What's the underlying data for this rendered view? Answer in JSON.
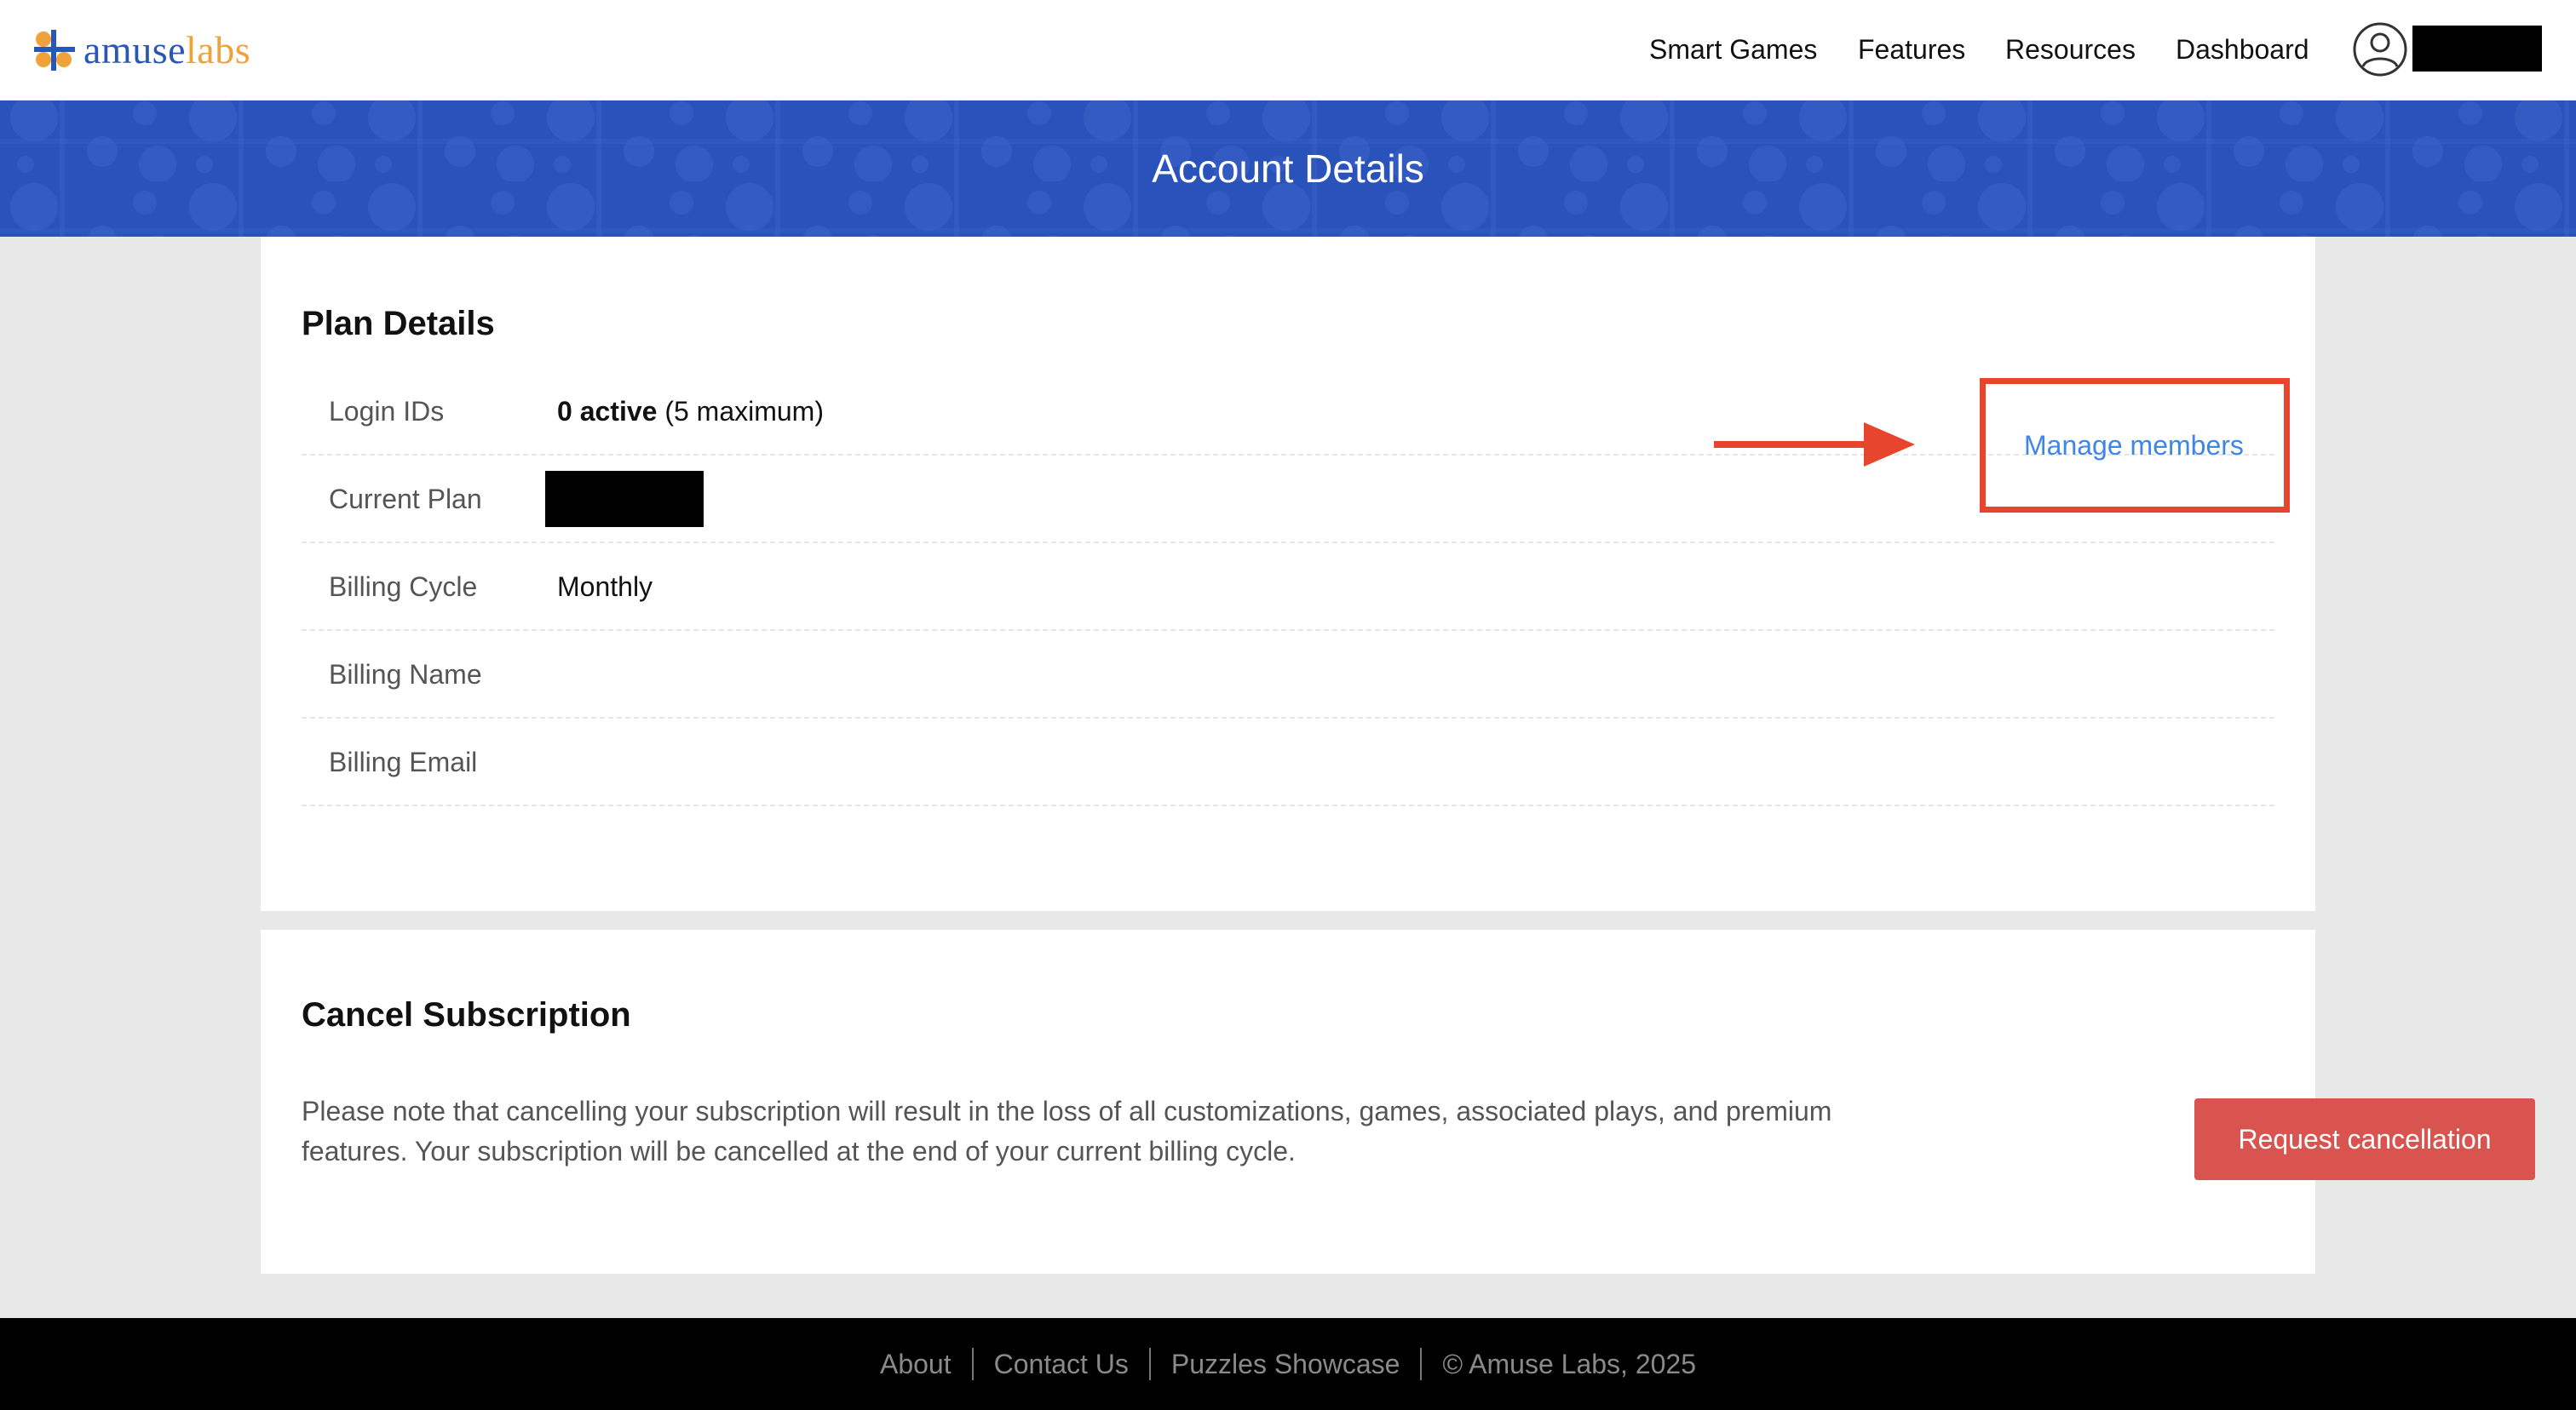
{
  "brand": {
    "logo_text_part1": "amuse",
    "logo_text_part2": "labs",
    "logo_color_blue": "#2a56b8",
    "logo_color_orange": "#f0a23a"
  },
  "nav": {
    "items": [
      {
        "label": "Smart Games"
      },
      {
        "label": "Features"
      },
      {
        "label": "Resources"
      },
      {
        "label": "Dashboard"
      }
    ],
    "avatar_icon": "user-circle-icon",
    "user_name": "[redacted]"
  },
  "hero": {
    "title": "Account Details",
    "background_color": "#2a52bb"
  },
  "plan_details": {
    "title": "Plan Details",
    "rows": [
      {
        "label": "Login IDs",
        "value_strong": "0 active",
        "value_rest": " (5 maximum)"
      },
      {
        "label": "Current Plan",
        "value": "[redacted]"
      },
      {
        "label": "Billing Cycle",
        "value": "Monthly"
      },
      {
        "label": "Billing Name",
        "value": ""
      },
      {
        "label": "Billing Email",
        "value": ""
      }
    ],
    "manage_members_label": "Manage members",
    "annotation_color": "#e8452e"
  },
  "cancel_subscription": {
    "title": "Cancel Subscription",
    "note": "Please note that cancelling your subscription will result in the loss of all customizations, games, associated plays, and premium features. Your subscription will be cancelled at the end of your current billing cycle.",
    "button_label": "Request cancellation",
    "button_color": "#d9534f"
  },
  "footer": {
    "links": [
      {
        "label": "About"
      },
      {
        "label": "Contact Us"
      },
      {
        "label": "Puzzles Showcase"
      }
    ],
    "copyright": "© Amuse Labs, 2025"
  }
}
